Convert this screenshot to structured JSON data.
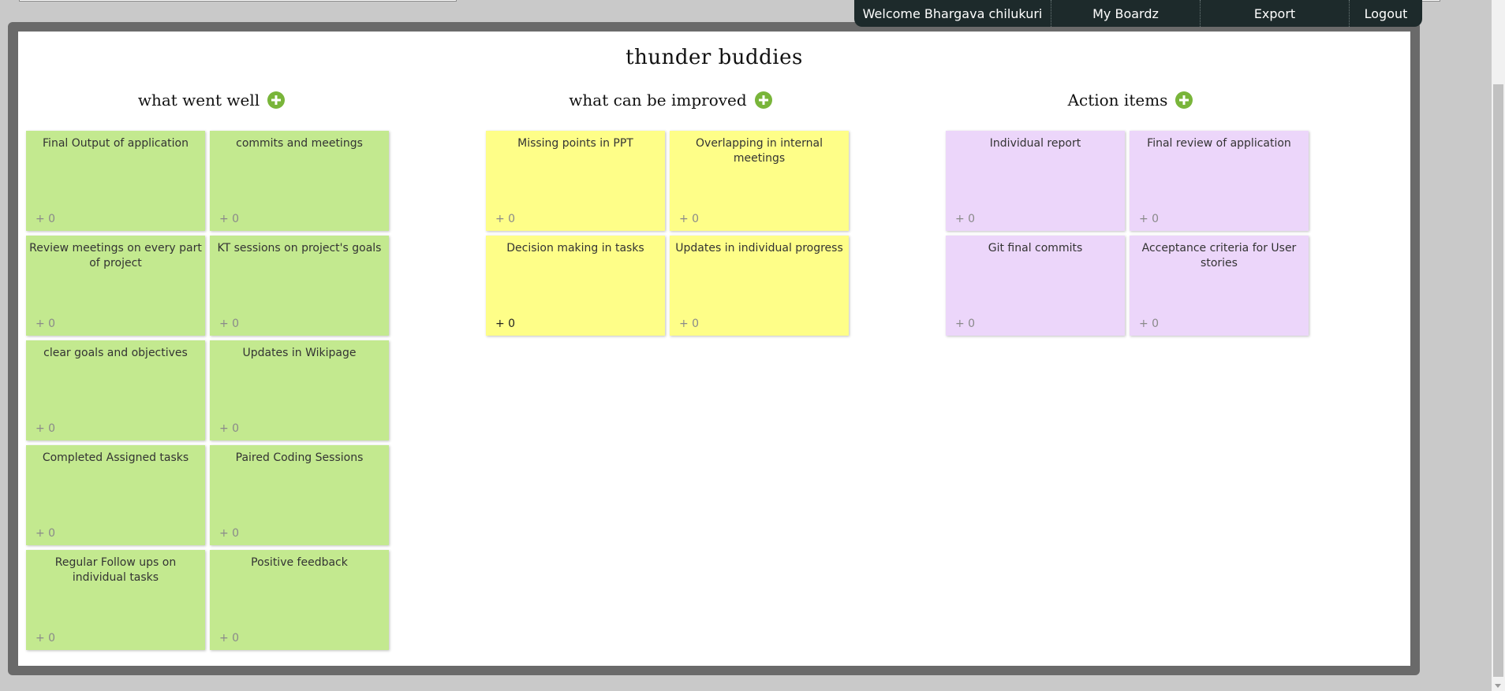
{
  "nav": {
    "welcome": "Welcome Bhargava chilukuri",
    "my_boardz": "My Boardz",
    "export": "Export",
    "logout": "Logout"
  },
  "board": {
    "title": "thunder buddies"
  },
  "colors": {
    "went_well": "#c3e98f",
    "improve": "#fefe88",
    "actions": "#ecd6fa",
    "add_button": "#79b53a",
    "nav_bg": "#1d2a2b"
  },
  "columns": [
    {
      "title": "what went well",
      "notes": [
        {
          "text": "Final Output of application",
          "votes": "+ 0"
        },
        {
          "text": "commits and meetings",
          "votes": "+ 0"
        },
        {
          "text": "Review meetings on every part of project",
          "votes": "+ 0"
        },
        {
          "text": "KT sessions on project's goals",
          "votes": "+ 0"
        },
        {
          "text": "clear goals and objectives",
          "votes": "+ 0"
        },
        {
          "text": "Updates in Wikipage",
          "votes": "+ 0"
        },
        {
          "text": "Completed Assigned tasks",
          "votes": "+ 0"
        },
        {
          "text": "Paired Coding Sessions",
          "votes": "+ 0"
        },
        {
          "text": "Regular Follow ups on individual tasks",
          "votes": "+ 0"
        },
        {
          "text": "Positive feedback",
          "votes": "+ 0"
        }
      ]
    },
    {
      "title": "what can be improved",
      "notes": [
        {
          "text": "Missing points in PPT",
          "votes": "+ 0"
        },
        {
          "text": "Overlapping in internal meetings",
          "votes": "+ 0"
        },
        {
          "text": "Decision making in tasks",
          "votes": "+ 0"
        },
        {
          "text": "Updates in individual progress",
          "votes": "+ 0"
        }
      ]
    },
    {
      "title": "Action items",
      "notes": [
        {
          "text": "Individual report",
          "votes": "+ 0"
        },
        {
          "text": "Final review of application",
          "votes": "+ 0"
        },
        {
          "text": "Git final commits",
          "votes": "+ 0"
        },
        {
          "text": "Acceptance criteria for User stories",
          "votes": "+ 0"
        }
      ]
    }
  ]
}
